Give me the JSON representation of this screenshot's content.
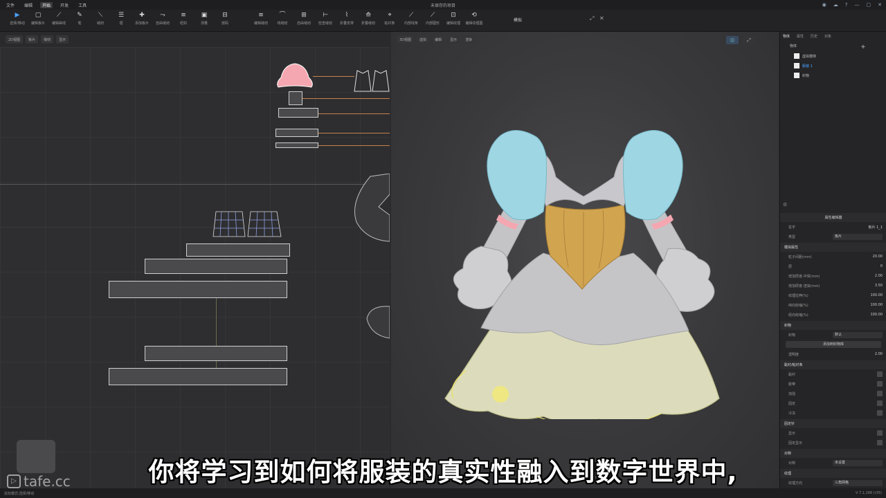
{
  "titlebar": {
    "menu": [
      "文件",
      "编辑",
      "开始",
      "开发",
      "工具"
    ],
    "active_menu": 2,
    "title": "未保存的项目",
    "right_icons": [
      "user-icon",
      "cloud-icon",
      "help-icon",
      "minimize-icon",
      "maximize-icon",
      "close-icon"
    ]
  },
  "toolbar": {
    "left_tools": [
      {
        "icon": "▶",
        "label": "选择/移动"
      },
      {
        "icon": "▢",
        "label": "编辑板片"
      },
      {
        "icon": "⟋",
        "label": "编辑曲线"
      },
      {
        "icon": "✎",
        "label": "笔"
      },
      {
        "icon": "⟍",
        "label": "缝纫"
      },
      {
        "icon": "☰",
        "label": "褶"
      },
      {
        "icon": "✚",
        "label": "添加板片"
      },
      {
        "icon": "⤳",
        "label": "自由缝纫"
      },
      {
        "icon": "≡",
        "label": "纽扣"
      },
      {
        "icon": "▣",
        "label": "测量"
      },
      {
        "icon": "⊟",
        "label": "放码"
      }
    ],
    "mid_tools": [
      {
        "icon": "≡",
        "label": "编辑缝纫"
      },
      {
        "icon": "⌒",
        "label": "线缝纫"
      },
      {
        "icon": "⊞",
        "label": "自由缝纫"
      },
      {
        "icon": "⊢",
        "label": "检查缝纫"
      },
      {
        "icon": "⌇",
        "label": "折叠安排"
      },
      {
        "icon": "⟰",
        "label": "折叠缝纫"
      },
      {
        "icon": "⌖",
        "label": "粘衬条"
      },
      {
        "icon": "⟋",
        "label": "内部线条"
      },
      {
        "icon": "⟋",
        "label": "内部图形"
      }
    ],
    "right_tools": [
      {
        "icon": "⊡",
        "label": "编辑纹理"
      },
      {
        "icon": "⟲",
        "label": "编辑纹理图"
      }
    ],
    "simulate_label": "模拟",
    "extra_icons": [
      "expand-icon",
      "close-panel-icon"
    ]
  },
  "pane2d": {
    "bar_buttons": [
      "2D视图",
      "板片",
      "缝纫",
      "显示"
    ]
  },
  "pane3d": {
    "bar_buttons": [
      "3D视图",
      "虚拟",
      "编辑",
      "显示",
      "渲染"
    ]
  },
  "props": {
    "tabs": [
      "物体",
      "属性",
      "历史",
      "对象"
    ],
    "list_header": "物体",
    "objects": [
      {
        "name": "虚拟模特",
        "selected": false
      },
      {
        "name": "服装 1",
        "selected": true
      },
      {
        "name": "织物",
        "selected": false
      }
    ],
    "panel_title": "属性编辑器",
    "name_label": "名字",
    "name_value": "板片 1_1",
    "type_label": "类型",
    "type_value": "板片",
    "section_sim": "模拟属性",
    "sim_rows": [
      {
        "label": "粒子间距(mm)",
        "value": "20.00"
      },
      {
        "label": "层",
        "value": "0"
      },
      {
        "label": "增加厚度-冲突(mm)",
        "value": "2.00"
      },
      {
        "label": "增加厚度-渲染(mm)",
        "value": "3.50"
      },
      {
        "label": "纹理拉伸(%)",
        "value": "100.00"
      },
      {
        "label": "纬向收缩(%)",
        "value": "100.00"
      },
      {
        "label": "经向收缩(%)",
        "value": "100.00"
      }
    ],
    "section_fabric": "织物",
    "fabric_label": "织物",
    "fabric_value": "默认",
    "fabric_button": "添加到织物库",
    "fabric_row": {
      "label": "透明度",
      "value": "2.00"
    },
    "section_attach": "黏衬/粘衬条",
    "attach_rows": [
      "黏衬",
      "胶带",
      "加强",
      "固定",
      "冷冻"
    ],
    "section_sew": "固定针",
    "sew_rows": [
      "显示",
      "固定显示"
    ],
    "section_sym": "对称",
    "sym_label": "对称",
    "sym_value": "未设置",
    "section_grain": "纹理",
    "grain_label": "纹理方向",
    "grain_value": "三角网格"
  },
  "status": {
    "left": "鼠标模式:选择/移动",
    "right": "V 7.1.268 (r35)"
  },
  "subtitle": "你将学习到如何将服装的真实性融入到数字世界中,",
  "watermark": "tafe.cc",
  "colors": {
    "puff_sleeve": "#9fd6e3",
    "bodice": "#c8c8cc",
    "corset": "#d1a450",
    "skirt_top": "#c5c5c8",
    "skirt_bottom": "#dcdcbc",
    "accent_pink": "#f4a7b0",
    "selection_blue": "#4aa3ff",
    "seam_orange": "#c5824a"
  }
}
